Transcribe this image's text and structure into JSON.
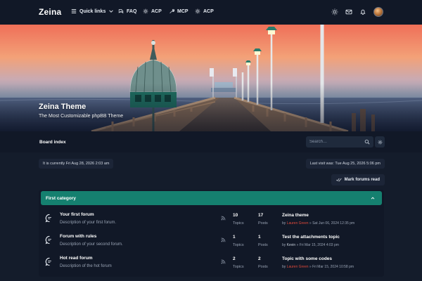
{
  "nav": {
    "brand": "Zeina",
    "links": [
      {
        "label": "Quick links",
        "icon": "menu-icon"
      },
      {
        "label": "FAQ",
        "icon": "faq-icon"
      },
      {
        "label": "ACP",
        "icon": "gear-icon"
      },
      {
        "label": "MCP",
        "icon": "wrench-icon"
      },
      {
        "label": "ACP",
        "icon": "gear-icon"
      }
    ],
    "right_icons": [
      "sun-icon",
      "mail-icon",
      "bell-icon",
      "avatar"
    ]
  },
  "hero": {
    "title": "Zeina Theme",
    "subtitle": "The Most Customizable phpBB Theme"
  },
  "boardbar": {
    "board_index": "Board index",
    "search_placeholder": "Search…"
  },
  "info": {
    "current_time": "It is currently Fri Aug 28, 2026 2:03 am",
    "last_visit": "Last visit was: Tue Aug 25, 2026 5:06 pm",
    "mark_read": "Mark forums read"
  },
  "category": {
    "title": "First category",
    "forums": [
      {
        "name": "Your first forum",
        "description": "Description of your first forum.",
        "topics": "10",
        "topics_label": "Topics",
        "posts": "17",
        "posts_label": "Posts",
        "last_title": "Zeina theme",
        "last_by": "by",
        "last_author": "Lauren Green",
        "last_date": "» Sat Jun 06, 2024 12:35 pm"
      },
      {
        "name": "Forum with rules",
        "description": "Description of your second forum.",
        "topics": "1",
        "topics_label": "Topics",
        "posts": "1",
        "posts_label": "Posts",
        "last_title": "Test the attachments topic",
        "last_by": "by",
        "last_author": "Kevin",
        "last_date": "» Fri Mar 15, 2024 4:03 pm"
      },
      {
        "name": "Hot read forum",
        "description": "Description of the hot forum",
        "topics": "2",
        "topics_label": "Topics",
        "posts": "2",
        "posts_label": "Posts",
        "last_title": "Topic with some codes",
        "last_by": "by",
        "last_author": "Lauren Green",
        "last_date": "» Fri Mar 15, 2024 10:58 pm"
      }
    ]
  },
  "colors": {
    "accent": "#15806f",
    "author_red": "#e14a3b",
    "page_bg": "#141c2b",
    "panel_bg": "#111827"
  }
}
